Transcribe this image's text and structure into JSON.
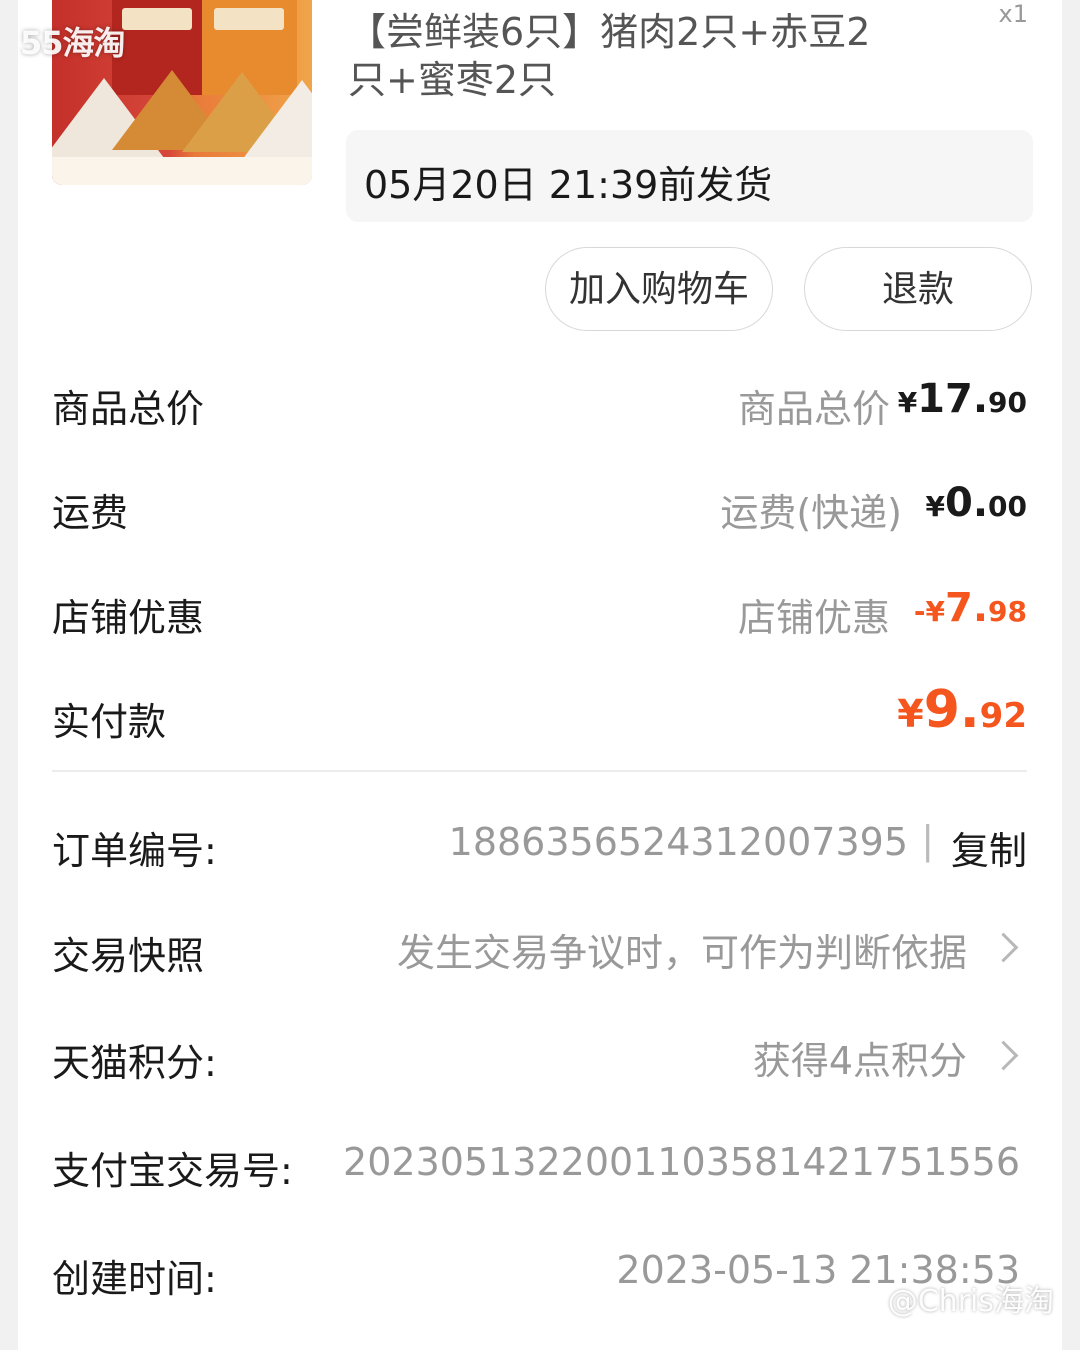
{
  "watermarks": {
    "top_left": "55海淘",
    "bottom_right": "@Chris海淘"
  },
  "product": {
    "title": "【尝鲜装6只】猪肉2只+赤豆2只+蜜枣2只",
    "quantity": "x1",
    "ship_by": "05月20日 21:39前发货",
    "image_icon": "zongzi-product-image"
  },
  "actions": {
    "add_to_cart": "加入购物车",
    "refund": "退款"
  },
  "price_rows": {
    "subtotal": {
      "label": "商品总价",
      "sub": "商品总价",
      "symbol": "¥",
      "int": "17.",
      "dec": "90"
    },
    "shipping": {
      "label": "运费",
      "sub": "运费(快递)",
      "symbol": "¥",
      "int": "0.",
      "dec": "00"
    },
    "store_discount": {
      "label": "店铺优惠",
      "sub": "店铺优惠",
      "symbol": "-¥",
      "int": "7.",
      "dec": "98"
    },
    "paid": {
      "label": "实付款",
      "symbol": "¥",
      "int": "9.",
      "dec": "92"
    }
  },
  "colors": {
    "accent": "#f5561d",
    "muted": "#999999"
  },
  "info": {
    "order_no": {
      "label": "订单编号:",
      "value": "1886356524312007395",
      "separator": "|",
      "copy": "复制"
    },
    "snapshot": {
      "label": "交易快照",
      "value": "发生交易争议时，可作为判断依据"
    },
    "points": {
      "label": "天猫积分:",
      "value": "获得4点积分"
    },
    "alipay_no": {
      "label": "支付宝交易号:",
      "value": "2023051322001103581421751556"
    },
    "created": {
      "label": "创建时间:",
      "value": "2023-05-13 21:38:53"
    }
  }
}
